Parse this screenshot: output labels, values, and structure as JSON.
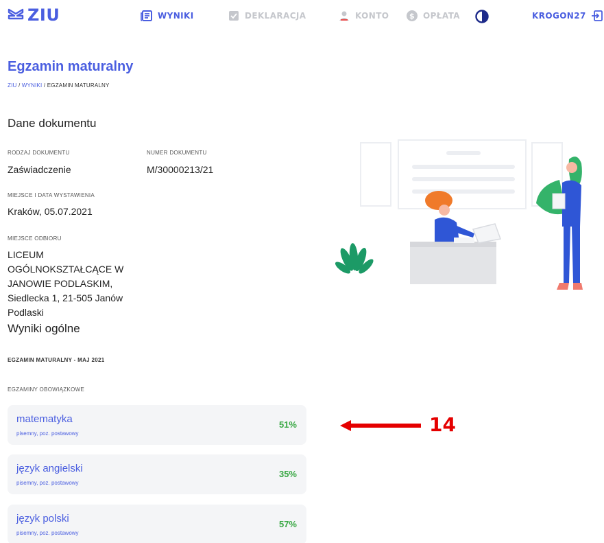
{
  "brand": {
    "name": "ZIU",
    "color": "#4a5ee0"
  },
  "nav": {
    "results": "WYNIKI",
    "declaration": "DEKLARACJA",
    "account": "KONTO",
    "fee": "OPŁATA",
    "user": "KROGON27"
  },
  "page": {
    "title": "Egzamin maturalny",
    "breadcrumb": [
      "ZIU",
      "WYNIKI",
      "EGZAMIN MATURALNY"
    ]
  },
  "document": {
    "section_title": "Dane dokumentu",
    "type_label": "RODZAJ DOKUMENTU",
    "type_value": "Zaświadczenie",
    "number_label": "NUMER DOKUMENTU",
    "number_value": "M/30000213/21",
    "place_label": "MIEJSCE I DATA WYSTAWIENIA",
    "place_value": "Kraków, 05.07.2021",
    "pickup_label": "MIEJSCE ODBIORU",
    "pickup_value": "LICEUM\nOGÓLNOKSZTAŁCĄCE W\nJANOWIE PODLASKIM,\nSiedlecka 1, 21-505 Janów\nPodlaski"
  },
  "results": {
    "section_title": "Wyniki ogólne",
    "exam_session": "EGZAMIN MATURALNY - MAJ 2021",
    "mandatory_label": "EGZAMINY OBOWIĄZKOWE",
    "exams": [
      {
        "subject": "matematyka",
        "detail": "pisemny, poz. postawowy",
        "score": "51%"
      },
      {
        "subject": "język angielski",
        "detail": "pisemny, poz. postawowy",
        "score": "35%"
      },
      {
        "subject": "język polski",
        "detail": "pisemny, poz. postawowy",
        "score": "57%"
      }
    ]
  },
  "annotation": {
    "number": "14",
    "color": "#e50000"
  },
  "colors": {
    "accent": "#4a5ee0",
    "muted_nav": "#c5c7cc",
    "score_green": "#3aa845",
    "card_bg": "#f4f5f7"
  }
}
